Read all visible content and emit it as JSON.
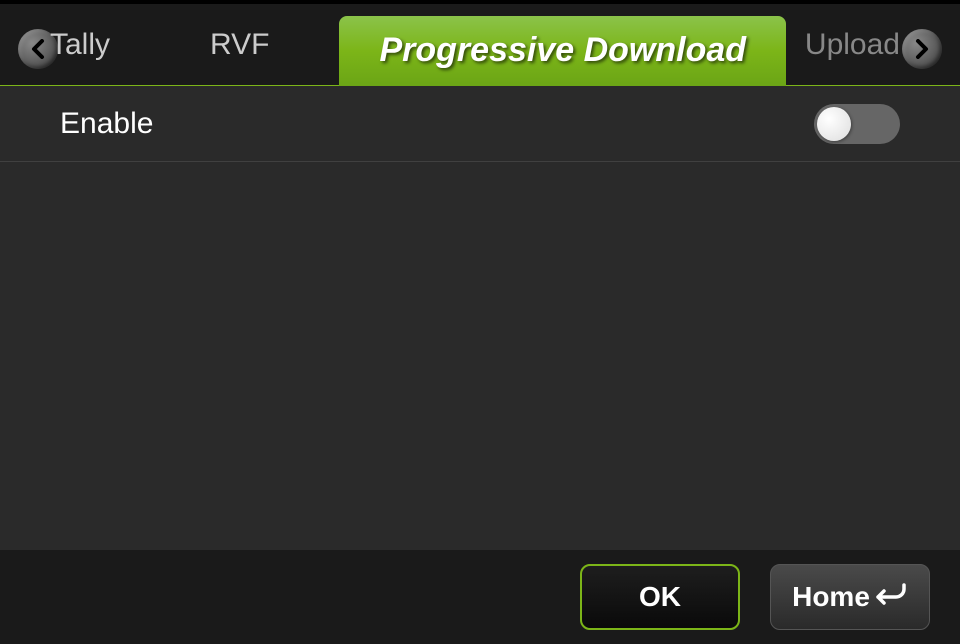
{
  "header": {
    "tabs": {
      "tally": "Tally",
      "rvf": "RVF",
      "progressive": "Progressive Download",
      "upload": "Upload"
    }
  },
  "content": {
    "enable_label": "Enable",
    "enable_value": false
  },
  "footer": {
    "ok_label": "OK",
    "home_label": "Home"
  },
  "colors": {
    "accent": "#7CB518"
  }
}
